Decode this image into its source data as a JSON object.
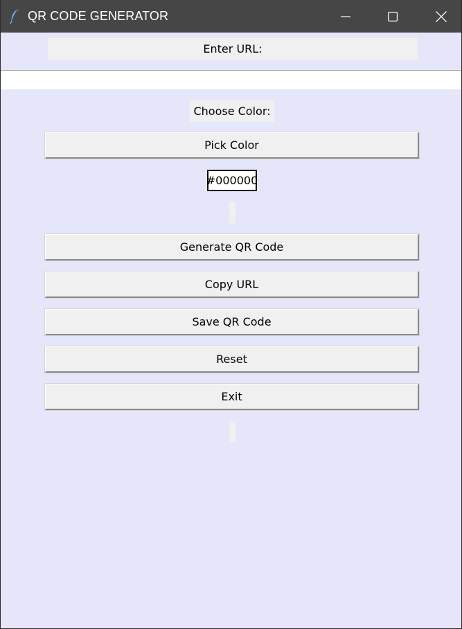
{
  "window": {
    "title": "QR CODE GENERATOR"
  },
  "form": {
    "url_label": "Enter URL:",
    "url_value": "",
    "color_label": "Choose Color:",
    "pick_color_label": "Pick Color",
    "color_value": "#000000"
  },
  "buttons": {
    "generate": "Generate QR Code",
    "copy": "Copy URL",
    "save": "Save QR Code",
    "reset": "Reset",
    "exit": "Exit"
  },
  "colors": {
    "background": "#e6e6fa",
    "titlebar": "#464646",
    "button_face": "#f0f0f0"
  },
  "icons": {
    "app": "feather-icon",
    "minimize": "minimize-icon",
    "maximize": "maximize-icon",
    "close": "close-icon"
  }
}
